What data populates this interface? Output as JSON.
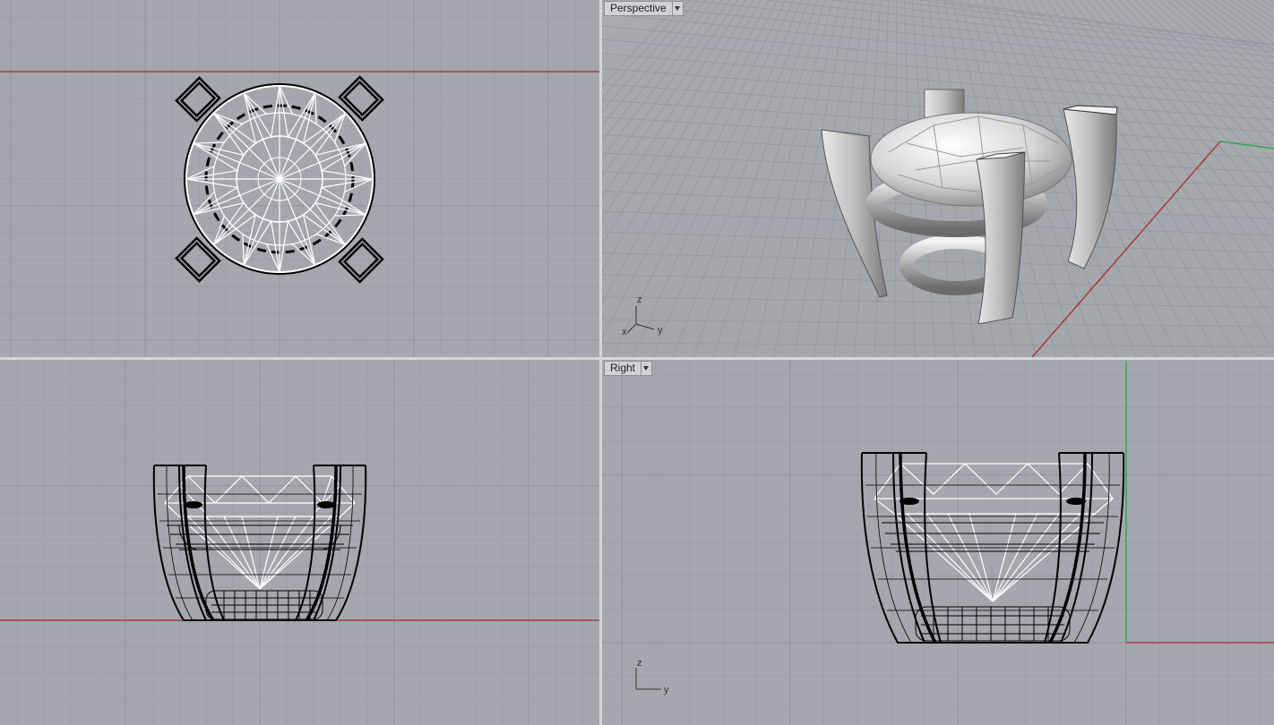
{
  "viewports": {
    "top": {
      "label": ""
    },
    "perspective": {
      "label": "Perspective"
    },
    "front": {
      "label": ""
    },
    "right": {
      "label": "Right"
    }
  },
  "axis_labels": {
    "x": "x",
    "y": "y",
    "z": "z"
  },
  "colors": {
    "viewport_bg": "#a3a8ae",
    "grid_minor": "#9aa0a6",
    "grid_major": "#8e949b",
    "x_axis": "#a83a3a",
    "y_axis": "#2fa84a",
    "separator": "#d6d6d6",
    "wire_dark": "#000000",
    "wire_light": "#ffffff"
  },
  "icons": {
    "viewport_menu": "chevron-down-icon"
  }
}
